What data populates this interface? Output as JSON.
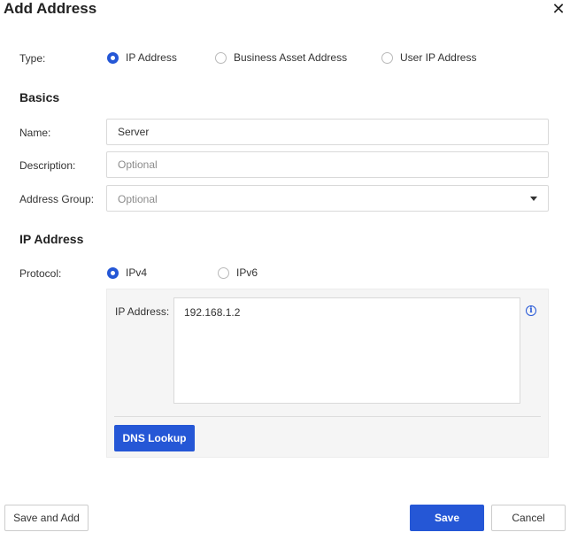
{
  "dialog": {
    "title": "Add Address"
  },
  "type": {
    "label": "Type:",
    "options": [
      {
        "label": "IP Address",
        "selected": true
      },
      {
        "label": "Business Asset Address",
        "selected": false
      },
      {
        "label": "User IP Address",
        "selected": false
      }
    ]
  },
  "basics": {
    "heading": "Basics",
    "name": {
      "label": "Name:",
      "value": "Server"
    },
    "description": {
      "label": "Description:",
      "placeholder": "Optional"
    },
    "address_group": {
      "label": "Address Group:",
      "placeholder": "Optional"
    }
  },
  "ip": {
    "heading": "IP Address",
    "protocol": {
      "label": "Protocol:",
      "options": [
        {
          "label": "IPv4",
          "selected": true
        },
        {
          "label": "IPv6",
          "selected": false
        }
      ]
    },
    "address": {
      "label": "IP Address:",
      "value": "192.168.1.2"
    },
    "dns_lookup": "DNS Lookup"
  },
  "footer": {
    "save_and_add": "Save and Add",
    "save": "Save",
    "cancel": "Cancel"
  },
  "colors": {
    "accent": "#2557d6",
    "panel_bg": "#f5f5f5",
    "border": "#d9d9d9"
  },
  "icons": {
    "close": "close-icon",
    "info": "info-icon",
    "dropdown": "chevron-down-icon"
  }
}
